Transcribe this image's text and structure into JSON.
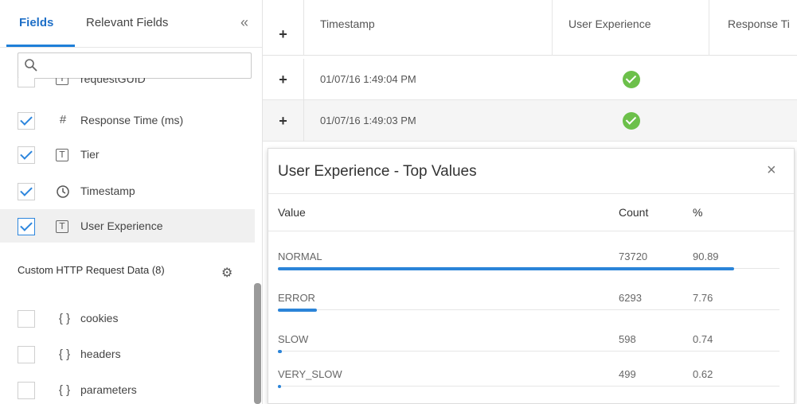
{
  "left_panel": {
    "tabs": [
      {
        "label": "Fields"
      },
      {
        "label": "Relevant Fields"
      }
    ],
    "collapse_icon": "«",
    "search": {
      "placeholder": "",
      "icon": "search-icon"
    },
    "fields": [
      {
        "icon": "T",
        "label": "requestGUID",
        "checked": false
      },
      {
        "icon": "#",
        "label": "Response Time (ms)",
        "checked": true
      },
      {
        "icon": "T",
        "label": "Tier",
        "checked": true
      },
      {
        "icon": "clock",
        "label": "Timestamp",
        "checked": true
      },
      {
        "icon": "T",
        "label": "User Experience",
        "checked": true
      }
    ],
    "section": {
      "title": "Custom HTTP Request Data (8)"
    },
    "custom_fields": [
      {
        "icon": "{ }",
        "label": "cookies",
        "checked": false
      },
      {
        "icon": "{ }",
        "label": "headers",
        "checked": false
      },
      {
        "icon": "{ }",
        "label": "parameters",
        "checked": false
      }
    ]
  },
  "table": {
    "header_plus": "+",
    "columns": [
      "Timestamp",
      "User Experience",
      "Response Ti"
    ],
    "rows": [
      {
        "plus": "+",
        "timestamp": "01/07/16 1:49:04 PM",
        "status": "ok"
      },
      {
        "plus": "+",
        "timestamp": "01/07/16 1:49:03 PM",
        "status": "ok"
      }
    ]
  },
  "popup": {
    "title": "User Experience - Top Values",
    "close_icon": "×",
    "headers": {
      "value": "Value",
      "count": "Count",
      "percent": "%"
    },
    "rows": [
      {
        "name": "NORMAL",
        "count": "73720",
        "percent": "90.89",
        "fraction": 0.9089
      },
      {
        "name": "ERROR",
        "count": "6293",
        "percent": "7.76",
        "fraction": 0.0776
      },
      {
        "name": "SLOW",
        "count": "598",
        "percent": "0.74",
        "fraction": 0.0074
      },
      {
        "name": "VERY_SLOW",
        "count": "499",
        "percent": "0.62",
        "fraction": 0.0062
      }
    ]
  },
  "colors": {
    "accent": "#1e7fd8",
    "success": "#6cc04a"
  }
}
